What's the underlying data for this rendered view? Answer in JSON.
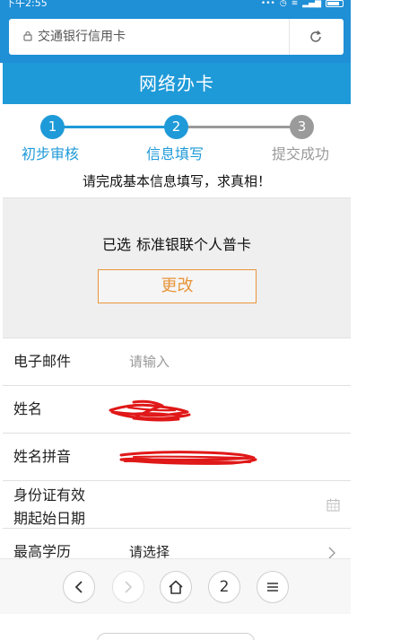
{
  "status_bar": {
    "time": "下午2:55"
  },
  "address_bar": {
    "url_text": "交通银行信用卡"
  },
  "header": {
    "title": "网络办卡"
  },
  "steps": [
    {
      "number": "1",
      "label": "初步审核"
    },
    {
      "number": "2",
      "label": "信息填写"
    },
    {
      "number": "3",
      "label": "提交成功"
    }
  ],
  "step_hint": "请完成基本信息填写，求真相！",
  "card": {
    "selected_prefix": "已选",
    "selected_name": "标准银联个人普卡",
    "change_label": "更改"
  },
  "form": {
    "email": {
      "label": "电子邮件",
      "placeholder": "请输入"
    },
    "name": {
      "label": "姓名"
    },
    "name_pinyin": {
      "label": "姓名拼音"
    },
    "id_start_date": {
      "label_line1": "身份证有效",
      "label_line2": "期起始日期"
    },
    "education": {
      "label": "最高学历",
      "value": "请选择"
    }
  },
  "bottom_nav": {
    "tab_count": "2"
  },
  "colors": {
    "brand_blue": "#1f9ad8",
    "inactive_gray": "#9a9a9a",
    "accent_orange": "#e8953a",
    "redaction_red": "#e01818"
  },
  "icons": [
    "lock-icon",
    "refresh-icon",
    "calendar-icon",
    "chevron-right-icon",
    "back-icon",
    "forward-icon",
    "home-icon",
    "menu-icon"
  ]
}
